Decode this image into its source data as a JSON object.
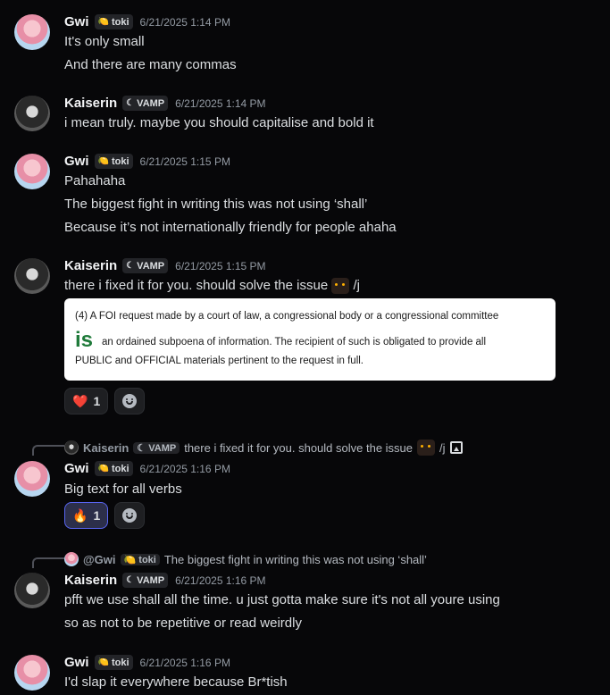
{
  "messages": [
    {
      "author": "Gwi",
      "tag": "toki",
      "tag_icon": "lemon",
      "time": "6/21/2025 1:14 PM",
      "lines": [
        "It's only small",
        "And there are many commas"
      ]
    },
    {
      "author": "Kaiserin",
      "tag": "VAMP",
      "tag_icon": "moon",
      "time": "6/21/2025 1:14 PM",
      "lines": [
        "i mean truly. maybe you should capitalise and bold it"
      ]
    },
    {
      "author": "Gwi",
      "tag": "toki",
      "tag_icon": "lemon",
      "time": "6/21/2025 1:15 PM",
      "lines": [
        "Pahahaha",
        "The biggest fight in writing this was not using ‘shall’",
        "Because it’s not internationally friendly for people ahaha"
      ]
    },
    {
      "author": "Kaiserin",
      "tag": "VAMP",
      "tag_icon": "moon",
      "time": "6/21/2025 1:15 PM",
      "lines": [
        "there i fixed it for you. should solve the issue",
        "/j"
      ]
    },
    {
      "author": "Gwi",
      "tag": "toki",
      "tag_icon": "lemon",
      "time": "6/21/2025 1:16 PM",
      "lines": [
        "Big text for all verbs"
      ]
    },
    {
      "author": "Kaiserin",
      "tag": "VAMP",
      "tag_icon": "moon",
      "time": "6/21/2025 1:16 PM",
      "lines": [
        "pfft we use shall all the time. u just gotta make sure it's not all youre using",
        "so as not to be repetitive or read weirdly"
      ]
    },
    {
      "author": "Gwi",
      "tag": "toki",
      "tag_icon": "lemon",
      "time": "6/21/2025 1:16 PM",
      "lines": [
        "I'd slap it everywhere because Br*tish"
      ]
    }
  ],
  "embed": {
    "line1": "(4) A FOI request made by a court of law, a congressional body or a congressional committee",
    "big": "is",
    "line2": "an ordained subpoena of information. The recipient of such is obligated to provide all",
    "line3": "PUBLIC and OFFICIAL materials pertinent to the request in full."
  },
  "reactions": {
    "msg4": {
      "emoji": "❤️",
      "count": "1"
    },
    "msg5": {
      "emoji": "🔥",
      "count": "1"
    }
  },
  "replies": {
    "msg5": {
      "author": "Kaiserin",
      "tag": "VAMP",
      "text": "there i fixed it for you. should solve the issue",
      "suffix": "/j"
    },
    "msg6": {
      "author": "@Gwi",
      "tag": "toki",
      "text": "The biggest fight in writing this was not using ‘shall’"
    }
  },
  "colors": {
    "background": "#070709",
    "accent": "#5865f2",
    "username": "#f2f3f5",
    "timestamp": "#949ba4"
  }
}
